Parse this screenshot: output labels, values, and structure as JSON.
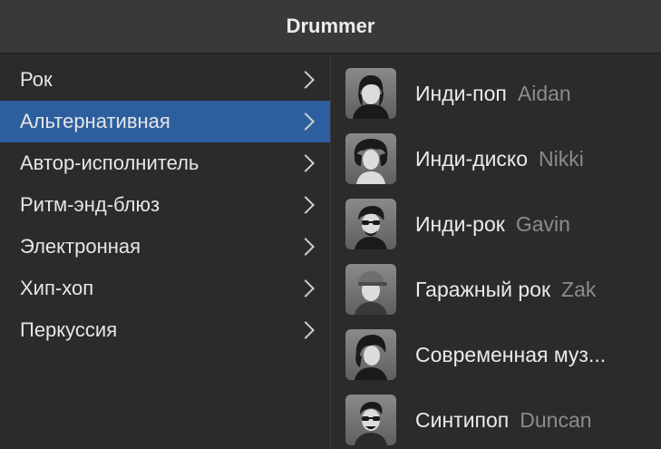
{
  "window": {
    "title": "Drummer"
  },
  "genres": [
    {
      "label": "Рок"
    },
    {
      "label": "Альтернативная"
    },
    {
      "label": "Автор-исполнитель"
    },
    {
      "label": "Ритм-энд-блюз"
    },
    {
      "label": "Электронная"
    },
    {
      "label": "Хип-хоп"
    },
    {
      "label": "Перкуссия"
    }
  ],
  "selected_genre": "Альтернативная",
  "drummers": [
    {
      "style": "Инди-поп",
      "name": "Aidan"
    },
    {
      "style": "Инди-диско",
      "name": "Nikki"
    },
    {
      "style": "Инди-рок",
      "name": "Gavin"
    },
    {
      "style": "Гаражный рок",
      "name": "Zak"
    },
    {
      "style": "Современная муз...",
      "name": ""
    },
    {
      "style": "Синтипоп",
      "name": "Duncan"
    }
  ],
  "colors": {
    "selection": "#2d5f9e",
    "background": "#2b2b2b",
    "titlebar": "#393939"
  }
}
